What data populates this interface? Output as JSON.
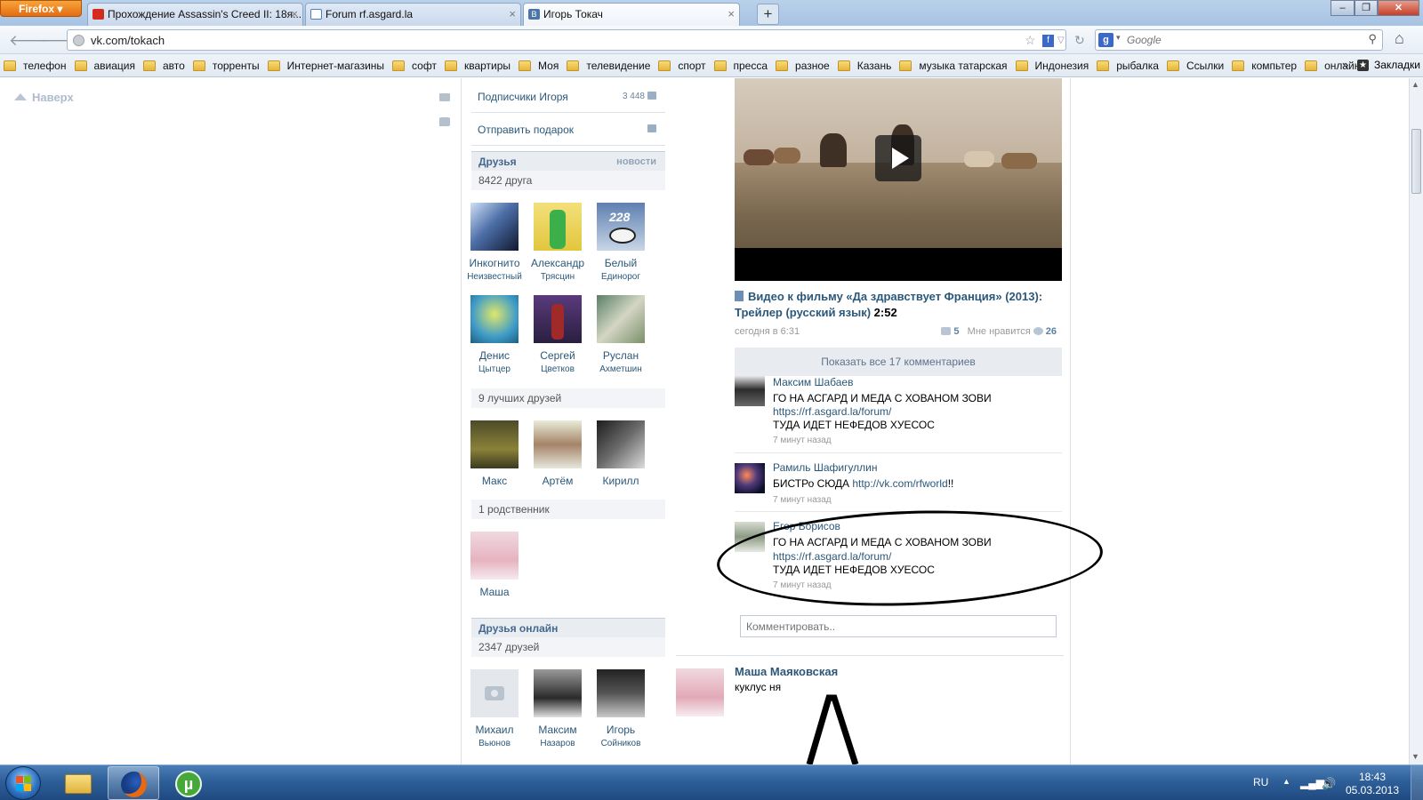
{
  "browser": {
    "firefox_label": "Firefox",
    "tabs": [
      {
        "title": "Прохождение Assassin's Creed II: 18я...",
        "favicon": "youtube-icon",
        "active": false
      },
      {
        "title": "Forum rf.asgard.la",
        "favicon": "forum-icon",
        "active": false
      },
      {
        "title": "Игорь Токач",
        "favicon": "vk-icon",
        "active": true
      }
    ],
    "url": "vk.com/tokach",
    "search_placeholder": "Google"
  },
  "bookmarks": [
    "телефон",
    "авиация",
    "авто",
    "торренты",
    "Интернет-магазины",
    "софт",
    "квартиры",
    "Моя",
    "телевидение",
    "спорт",
    "пресса",
    "разное",
    "Казань",
    "музыка татарская",
    "Индонезия",
    "рыбалка",
    "Ссылки",
    "компьтер",
    "онлайн"
  ],
  "bookmarks_more": "»",
  "bookmarks_menu": "Закладки",
  "page": {
    "up_link": "Наверх",
    "left": {
      "subscribers_label": "Подписчики Игоря",
      "subscribers_count": "3 448",
      "send_gift": "Отправить подарок",
      "friends_header": "Друзья",
      "friends_news": "новости",
      "friends_count": "8422 друга",
      "friends": [
        {
          "first": "Инкогнито",
          "last": "Неизвестный"
        },
        {
          "first": "Александр",
          "last": "Трясцин"
        },
        {
          "first": "Белый",
          "last": "Единорог"
        },
        {
          "first": "Денис",
          "last": "Цытцер"
        },
        {
          "first": "Сергей",
          "last": "Цветков"
        },
        {
          "first": "Руслан",
          "last": "Ахметшин"
        }
      ],
      "best_friends_header": "9 лучших друзей",
      "best_friends": [
        "Макс",
        "Артём",
        "Кирилл"
      ],
      "relatives_header": "1 родственник",
      "relatives": [
        "Маша"
      ],
      "online_header": "Друзья онлайн",
      "online_count": "2347 друзей",
      "online_friends": [
        {
          "first": "Михаил",
          "last": "Вьюнов"
        },
        {
          "first": "Максим",
          "last": "Назаров"
        },
        {
          "first": "Игорь",
          "last": "Сойников"
        }
      ],
      "avatar_228_text": "228"
    },
    "feed": {
      "video_title": "Видео к фильму «Да здравствует Франция» (2013): Трейлер (русский язык)",
      "video_duration": "2:52",
      "post_time": "сегодня в 6:31",
      "reposts": "5",
      "like_label": "Мне нравится",
      "likes": "26",
      "show_all": "Показать все 17 комментариев",
      "comments": [
        {
          "author": "Максим Шабаев",
          "line1": "ГО НА АСГАРД И МЕДА С ХОВАНОМ ЗОВИ",
          "link": "https://rf.asgard.la/forum/",
          "line2": "ТУДА ИДЕТ НЕФЕДОВ ХУЕСОС",
          "time": "7 минут назад"
        },
        {
          "author": "Рамиль Шафигуллин",
          "text_before": "БИСТРо СЮДА ",
          "link": "http://vk.com/rfworld",
          "text_after": "!!",
          "time": "7 минут назад"
        },
        {
          "author": "Егор Борисов",
          "line1": "ГО НА АСГАРД И МЕДА С ХОВАНОМ ЗОВИ",
          "link": "https://rf.asgard.la/forum/",
          "line2": "ТУДА ИДЕТ НЕФЕДОВ ХУЕСОС",
          "time": "7 минут назад"
        }
      ],
      "comment_placeholder": "Комментировать..",
      "post2_author": "Маша Маяковская",
      "post2_text": "куклус ня"
    }
  },
  "taskbar": {
    "lang": "RU",
    "time": "18:43",
    "date": "05.03.2013"
  },
  "colors": {
    "vk_link": "#2b587a",
    "accent_orange": "#e46c12"
  }
}
